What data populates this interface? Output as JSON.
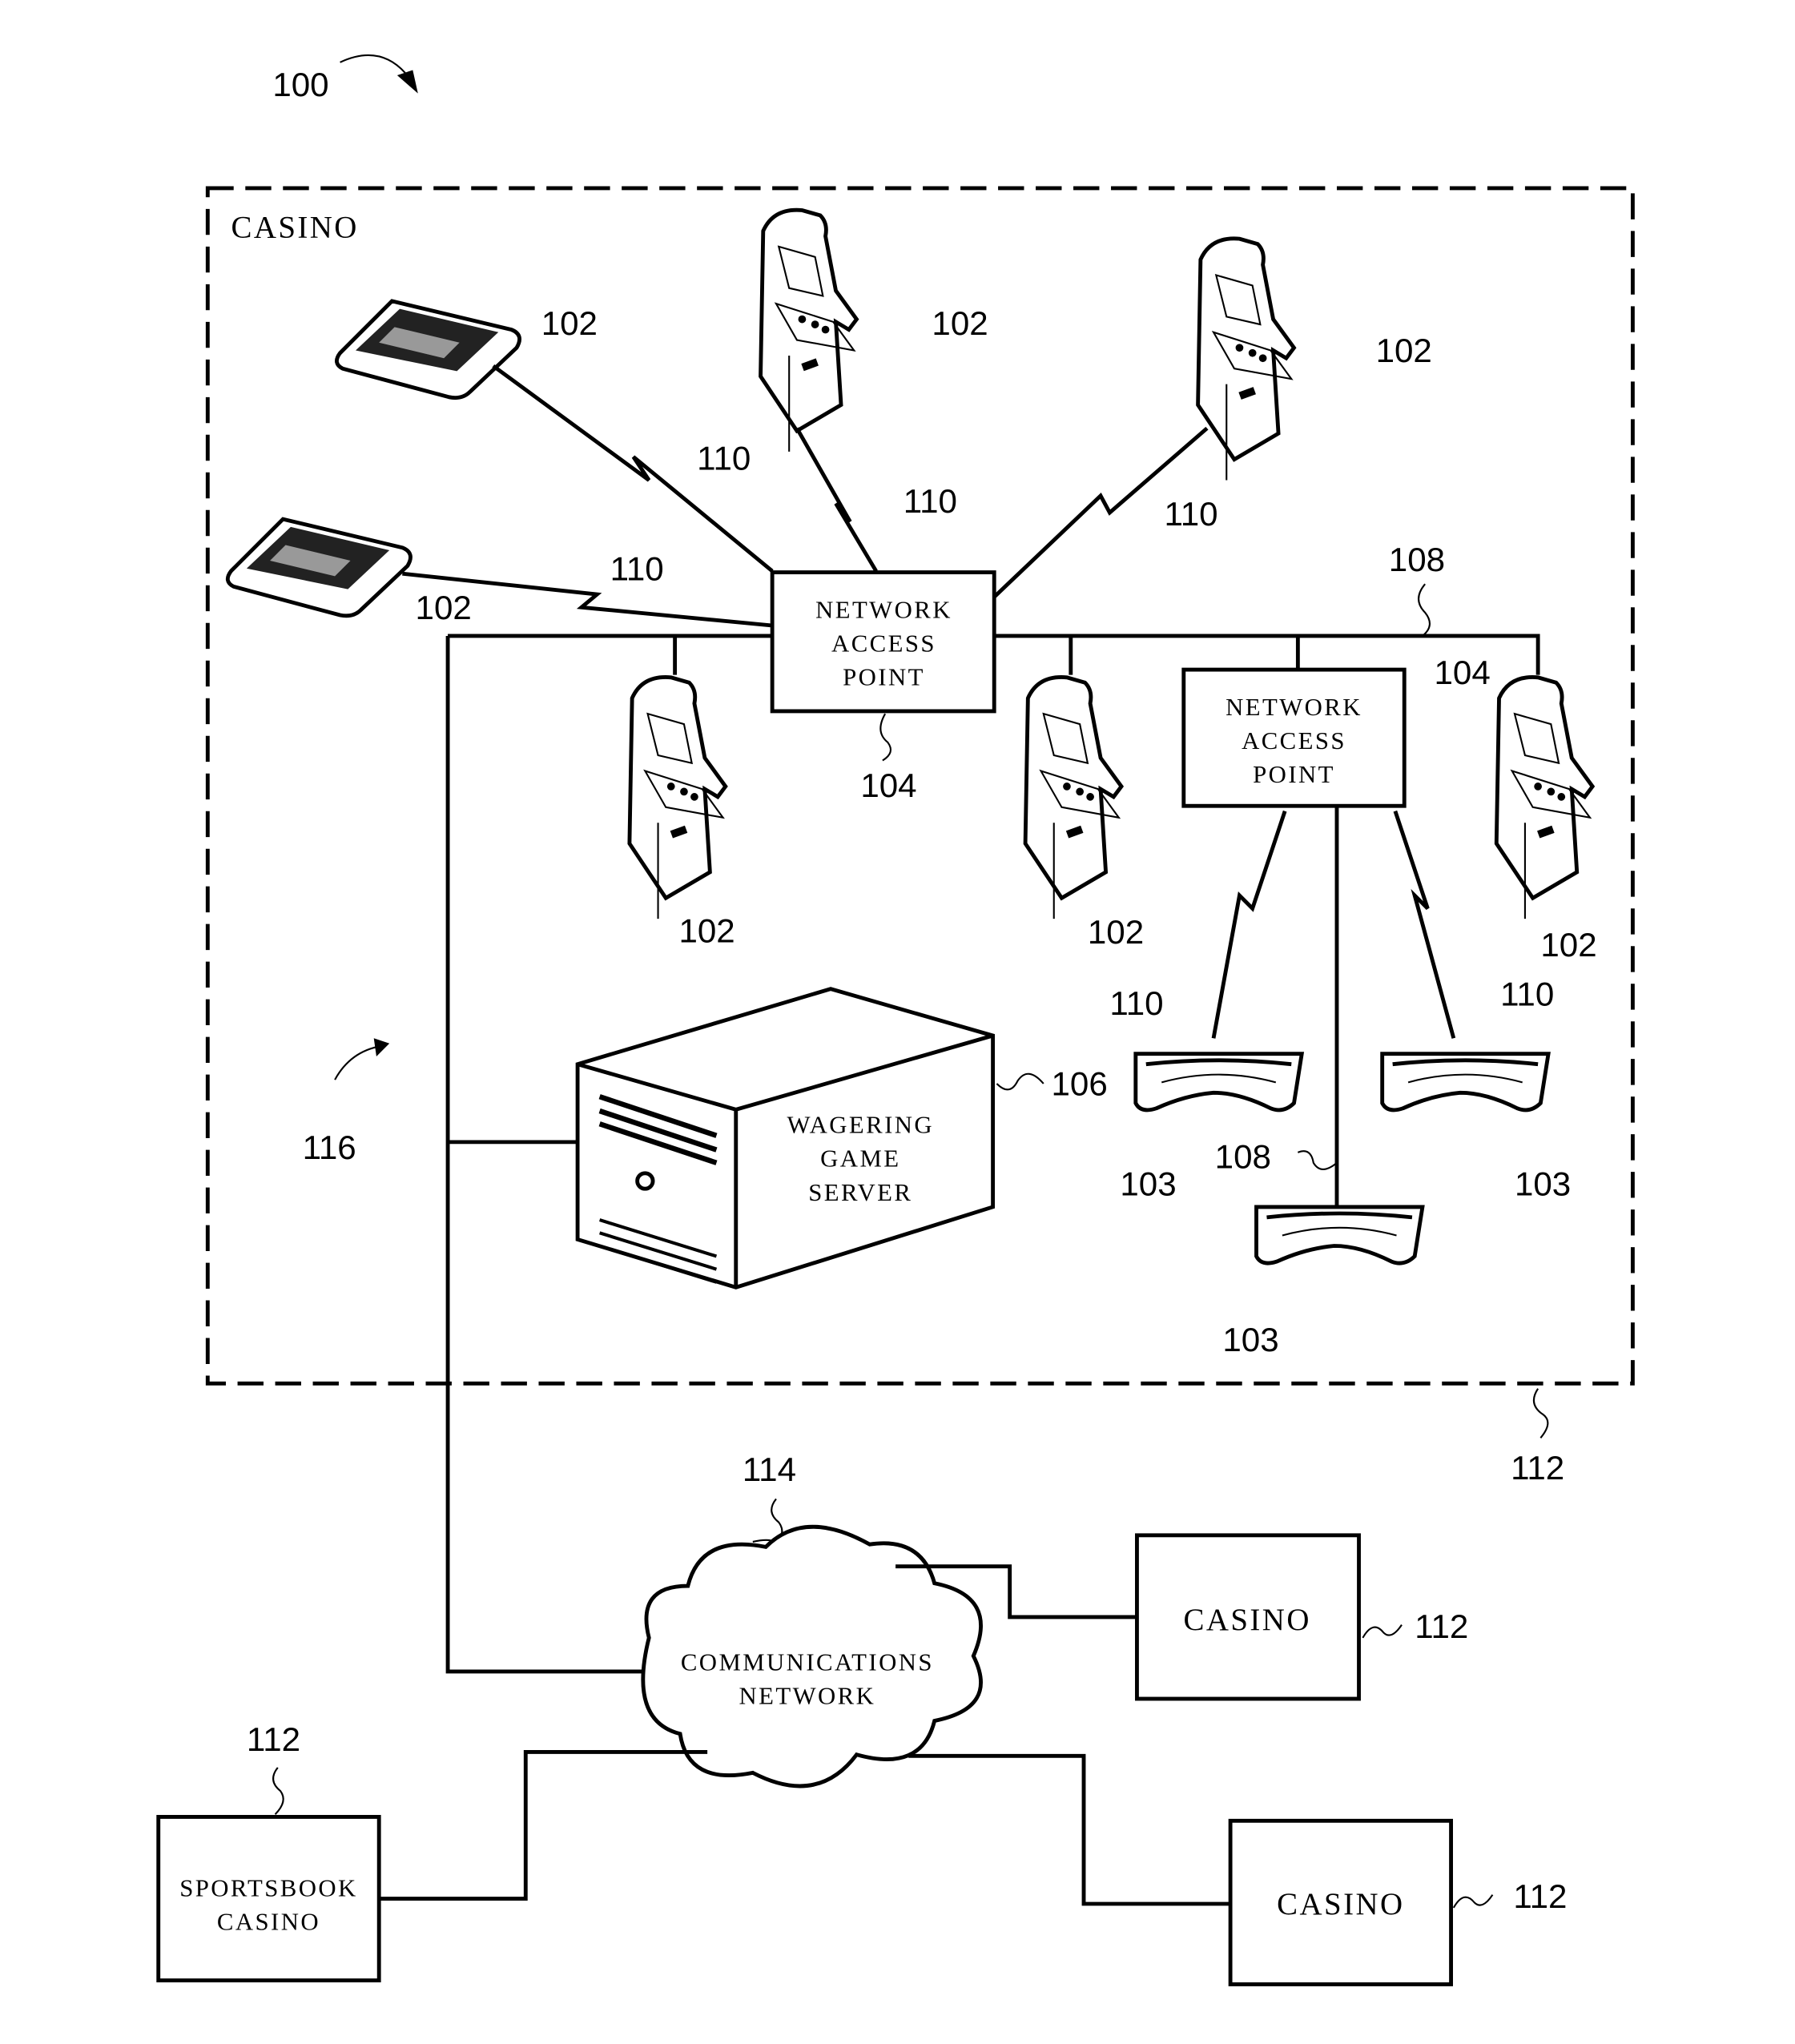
{
  "figure": {
    "ref": "100",
    "casino_region": {
      "label": "CASINO",
      "ref": "112"
    },
    "environment_ref": "116",
    "network_access_points": [
      {
        "label_lines": [
          "NETWORK",
          "ACCESS",
          "POINT"
        ],
        "ref": "104"
      },
      {
        "label_lines": [
          "NETWORK",
          "ACCESS",
          "POINT"
        ],
        "ref": "104"
      }
    ],
    "server": {
      "label_lines": [
        "WAGERING",
        "GAME",
        "SERVER"
      ],
      "ref": "106"
    },
    "communications_network": {
      "label_lines": [
        "COMMUNICATIONS",
        "NETWORK"
      ],
      "ref": "114"
    },
    "wired_ref": "108",
    "wireless_ref": "110",
    "device_ref": "102",
    "headset_ref": "103",
    "external_sites": [
      {
        "label_lines": [
          "CASINO"
        ],
        "ref": "112"
      },
      {
        "label_lines": [
          "CASINO"
        ],
        "ref": "112"
      },
      {
        "label_lines": [
          "SPORTSBOOK",
          "CASINO"
        ],
        "ref": "112"
      }
    ]
  }
}
